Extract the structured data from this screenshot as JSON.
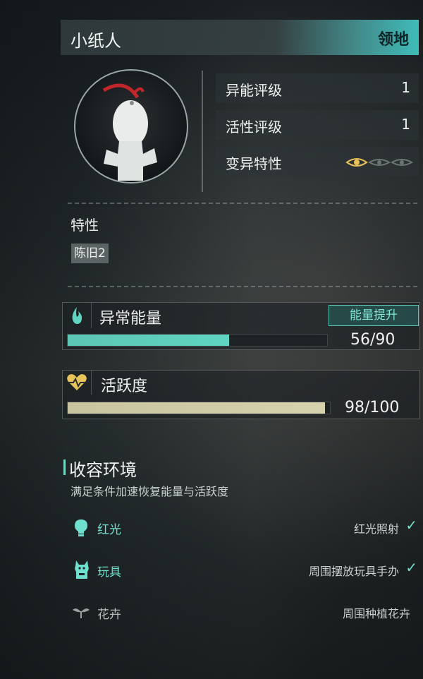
{
  "header": {
    "title": "小纸人",
    "tag": "领地"
  },
  "stats": [
    {
      "label": "异能评级",
      "value": "1"
    },
    {
      "label": "活性评级",
      "value": "1"
    },
    {
      "label": "变异特性",
      "value": ""
    }
  ],
  "traits": {
    "heading": "特性",
    "chip": "陈旧2"
  },
  "energy": {
    "title": "异常能量",
    "button": "能量提升",
    "value_text": "56/90",
    "current": 56,
    "max": 90,
    "color": "#5fd4c0"
  },
  "activity": {
    "title": "活跃度",
    "value_text": "98/100",
    "current": 98,
    "max": 100,
    "color": "#d2cdaa"
  },
  "environment": {
    "title": "收容环境",
    "subtitle": "满足条件加速恢复能量与活跃度",
    "items": [
      {
        "name": "红光",
        "condition": "红光照射",
        "met": true,
        "icon": "lightbulb-icon"
      },
      {
        "name": "玩具",
        "condition": "周围摆放玩具手办",
        "met": true,
        "icon": "toy-icon"
      },
      {
        "name": "花卉",
        "condition": "周围种植花卉",
        "met": false,
        "icon": "sprout-icon"
      }
    ]
  },
  "colors": {
    "accent": "#5fd4c0",
    "gold": "#e8c35a"
  }
}
